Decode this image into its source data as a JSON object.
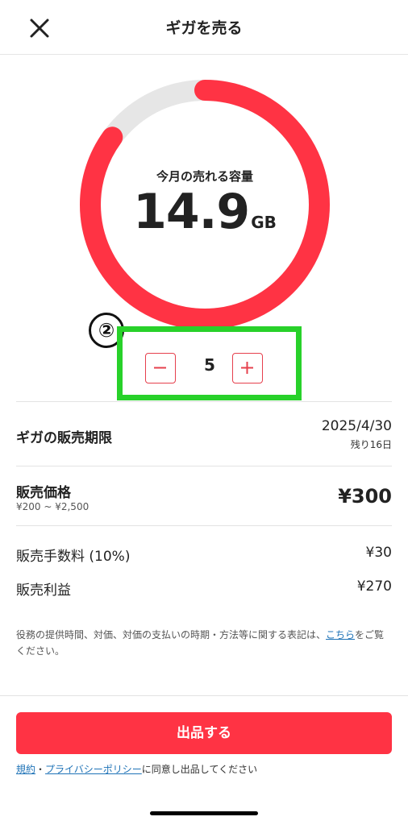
{
  "header": {
    "title": "ギガを売る",
    "close_icon": "close-icon"
  },
  "gauge": {
    "label": "今月の売れる容量",
    "value": "14.9",
    "unit": "GB",
    "fill_fraction": 0.85,
    "colors": {
      "fill": "#ff3344",
      "track": "#e6e6e6"
    }
  },
  "annotation": {
    "badge": "②",
    "highlight_color": "#28d12a"
  },
  "stepper": {
    "value": "5",
    "minus_label": "−",
    "plus_label": "+"
  },
  "rows": {
    "deadline": {
      "label": "ギガの販売期限",
      "date": "2025/4/30",
      "remaining": "残り16日"
    },
    "price": {
      "label": "販売価格",
      "range": "¥200 ~ ¥2,500",
      "value": "¥300"
    },
    "fee": {
      "label": "販売手数料 (10%)",
      "value": "¥30"
    },
    "profit": {
      "label": "販売利益",
      "value": "¥270"
    }
  },
  "notice": {
    "text_before": "役務の提供時間、対価、対価の支払いの時期・方法等に関する表記は、",
    "link": "こちら",
    "text_after": "をご覧ください。"
  },
  "cta": {
    "label": "出品する"
  },
  "agreement": {
    "terms_link": "規約",
    "separator": "・",
    "privacy_link": "プライバシーポリシー",
    "suffix": "に同意し出品してください"
  }
}
